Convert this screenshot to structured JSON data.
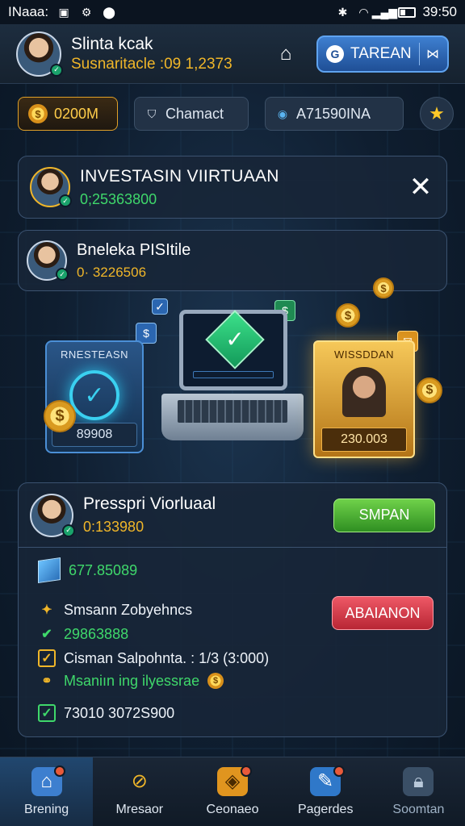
{
  "status_bar": {
    "carrier": "INaaa:",
    "time": "39:50"
  },
  "header": {
    "user_name": "Slinta kcak",
    "user_sub": "Susnaritacle :09 1,2373",
    "action_label": "TAREAN"
  },
  "chips": {
    "coins": "0200M",
    "chat": "Chamact",
    "id": "A71590INA"
  },
  "banner": {
    "title": "INVESTASIN VIIRTUAAN",
    "value": "0;25363800"
  },
  "profile_card": {
    "name": "Bneleka PISItile",
    "value": "0· 3226506"
  },
  "illustration": {
    "left_panel_title": "RNESTEASN",
    "left_panel_value": "89908",
    "right_panel_title": "WISSDDAN",
    "right_panel_value": "230.003"
  },
  "main_card": {
    "title": "Presspri Viorluaal",
    "value": "0:133980",
    "primary_button": "SMPAN",
    "row1_value": "677.85089",
    "row2_label": "Smsann Zobyehncs",
    "row2_value": "29863888",
    "secondary_button": "ABAIANON",
    "row3_label": "Cisman Salpohnta. : 1/3 (3:000)",
    "row4_label": "Msaniın ing ilyessrae",
    "row5_value": "73010 3072S900"
  },
  "bottom_nav": [
    {
      "label": "Brening",
      "icon": "home-icon"
    },
    {
      "label": "Mresaor",
      "icon": "wrench-icon"
    },
    {
      "label": "Ceonaeo",
      "icon": "money-bag-icon"
    },
    {
      "label": "Pagerdes",
      "icon": "pencil-icon"
    },
    {
      "label": "Soomtan",
      "icon": "lock-icon"
    }
  ],
  "colors": {
    "accent_gold": "#f0b629",
    "accent_green": "#3fd86b",
    "button_blue": "#3e7fd0",
    "button_red": "#ee5866"
  }
}
